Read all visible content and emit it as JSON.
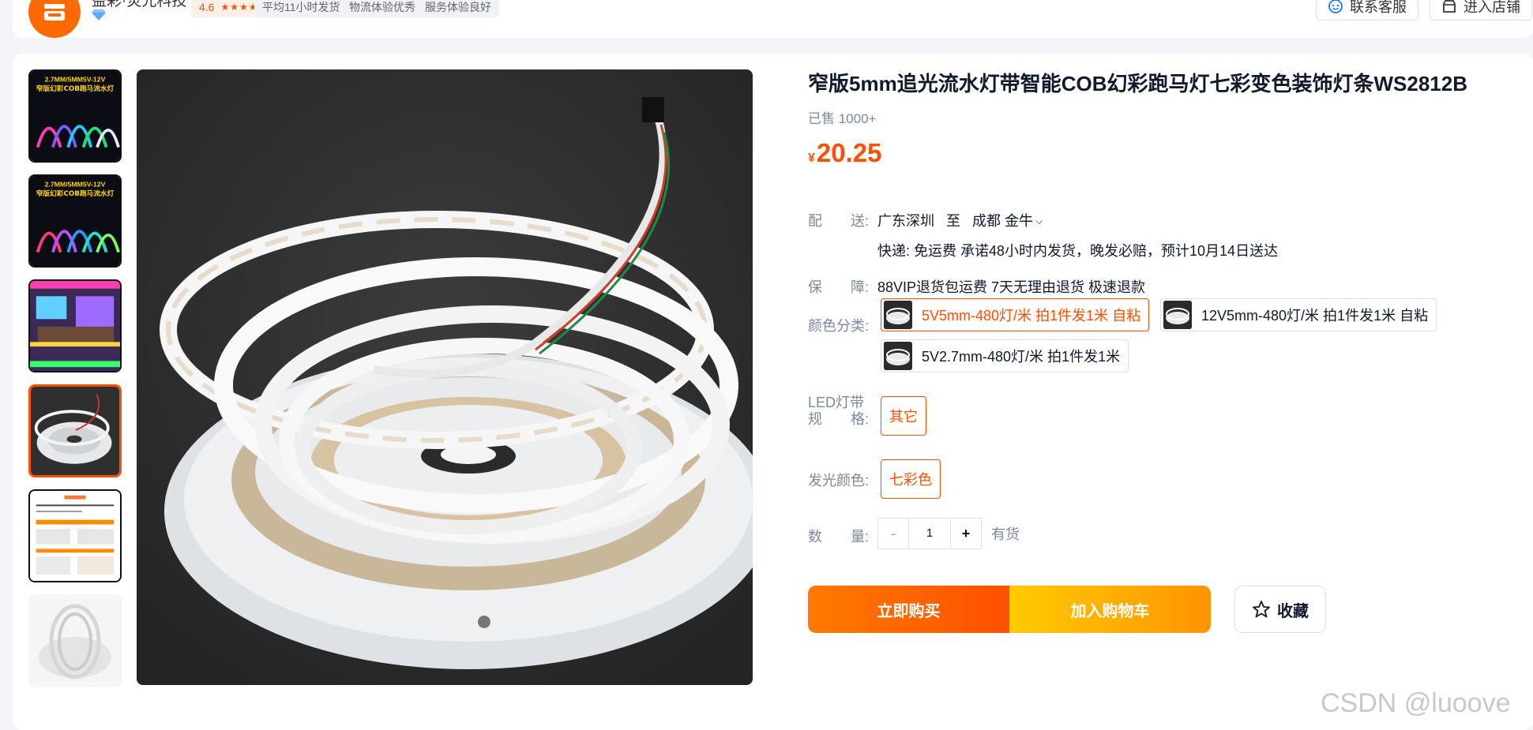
{
  "header": {
    "shop_name": "益彩·荧光科技",
    "rating": "4.6",
    "rating_stars": "★★★★★",
    "tags": [
      "平均11小时发货",
      "物流体验优秀",
      "服务体验良好"
    ],
    "contact_label": "联系客服",
    "enter_shop_label": "进入店铺"
  },
  "gallery": {
    "thumb_text": "2.7MM/5MM5V-12V",
    "thumb_subtext": "窄版幻彩COB跑马流水灯",
    "selected_index": 4
  },
  "product": {
    "title": "窄版5mm追光流水灯带智能COB幻彩跑马灯七彩变色装饰灯条WS2812B",
    "sold": "已售 1000+",
    "price_symbol": "¥",
    "price": "20.25"
  },
  "shipping": {
    "label": "配　　送:",
    "from": "广东深圳",
    "to_word": "至",
    "to": "成都 金牛",
    "detail": "快递: 免运费  承诺48小时内发货，晚发必赔，预计10月14日送达"
  },
  "guarantee": {
    "label": "保　　障:",
    "value": "88VIP退货包运费 7天无理由退货 极速退款"
  },
  "color_options": {
    "label": "颜色分类:",
    "options": [
      "5V5mm-480灯/米 拍1件发1米 自粘",
      "12V5mm-480灯/米 拍1件发1米 自粘",
      "5V2.7mm-480灯/米 拍1件发1米"
    ]
  },
  "spec": {
    "label_line1": "LED灯带",
    "label_line2": "规　　格:",
    "value": "其它"
  },
  "light_color": {
    "label": "发光颜色:",
    "value": "七彩色"
  },
  "quantity": {
    "label": "数　　量:",
    "minus": "-",
    "value": "1",
    "plus": "+",
    "stock": "有货"
  },
  "actions": {
    "buy_now": "立即购买",
    "add_cart": "加入购物车",
    "favorite": "收藏"
  },
  "watermark": "CSDN @luoove",
  "colors": {
    "accent": "#ff5000",
    "cart_gradient_start": "#ffcb00",
    "muted_text": "#7c889c"
  }
}
